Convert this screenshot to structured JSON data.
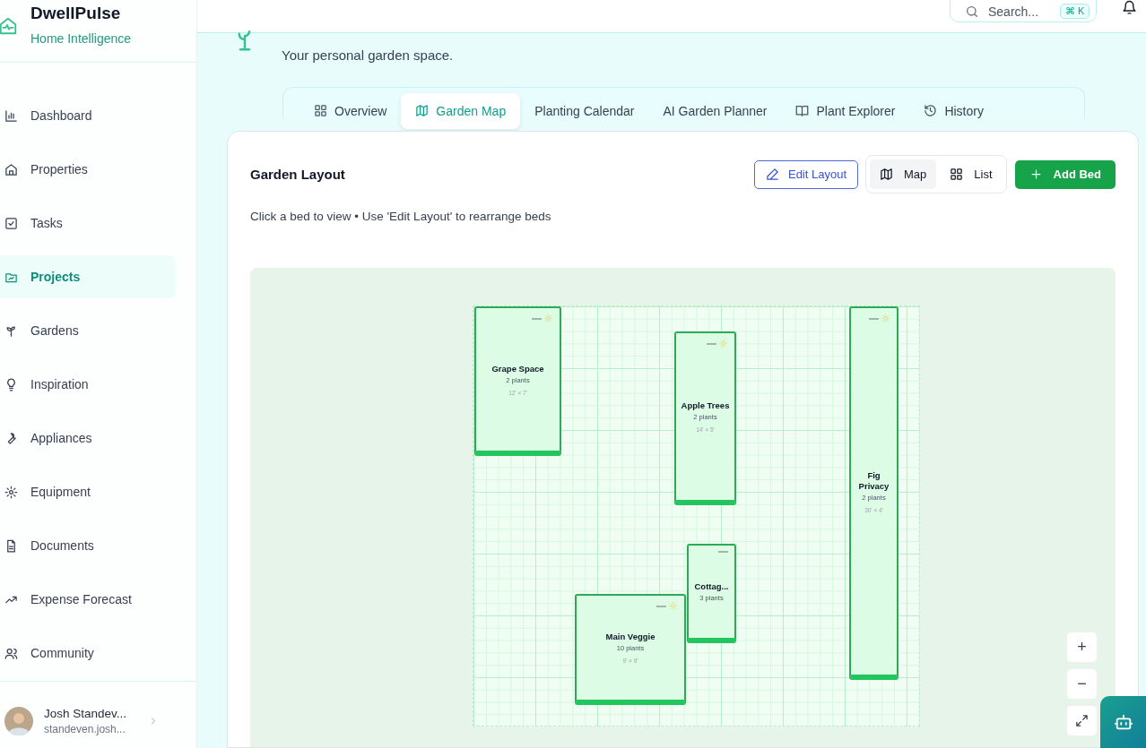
{
  "brand": {
    "name": "DwellPulse",
    "tagline": "Home Intelligence"
  },
  "sidebar": {
    "items": [
      {
        "label": "Dashboard",
        "selected": false
      },
      {
        "label": "Properties",
        "selected": false
      },
      {
        "label": "Tasks",
        "selected": false
      },
      {
        "label": "Projects",
        "selected": true
      },
      {
        "label": "Gardens",
        "selected": false
      },
      {
        "label": "Inspiration",
        "selected": false
      },
      {
        "label": "Appliances",
        "selected": false
      },
      {
        "label": "Equipment",
        "selected": false
      },
      {
        "label": "Documents",
        "selected": false
      },
      {
        "label": "Expense Forecast",
        "selected": false
      },
      {
        "label": "Community",
        "selected": false
      }
    ],
    "user": {
      "name": "Josh Standev...",
      "email": "standeven.josh..."
    }
  },
  "search": {
    "placeholder": "Search...",
    "shortcut": "⌘ K"
  },
  "page": {
    "subtitle": "Your personal garden space."
  },
  "tabs": [
    {
      "label": "Overview",
      "selected": false
    },
    {
      "label": "Garden Map",
      "selected": true
    },
    {
      "label": "Planting Calendar",
      "selected": false
    },
    {
      "label": "AI Garden Planner",
      "selected": false
    },
    {
      "label": "Plant Explorer",
      "selected": false
    },
    {
      "label": "History",
      "selected": false
    }
  ],
  "layout": {
    "title": "Garden Layout",
    "hint": "Click a bed to view • Use 'Edit Layout' to rearrange beds",
    "edit_button": "Edit Layout",
    "views": [
      {
        "label": "Map",
        "selected": true
      },
      {
        "label": "List",
        "selected": false
      }
    ],
    "add_button": "Add Bed"
  },
  "beds": [
    {
      "name": "Grape Space",
      "plants": "2 plants",
      "size": "12' × 7'",
      "sun": true
    },
    {
      "name": "Apple Trees",
      "plants": "2 plants",
      "size": "14' × 5'",
      "sun": true
    },
    {
      "name": "Fig Privacy",
      "plants": "2 plants",
      "size": "30' × 4'",
      "sun": true
    },
    {
      "name": "Cottag...",
      "plants": "3 plants",
      "sun": false
    },
    {
      "name": "Main Veggie",
      "plants": "10 plants",
      "size": "9' × 9'",
      "sun": true
    }
  ],
  "zoom_controls": [
    {
      "label": "+"
    },
    {
      "label": "−"
    }
  ]
}
